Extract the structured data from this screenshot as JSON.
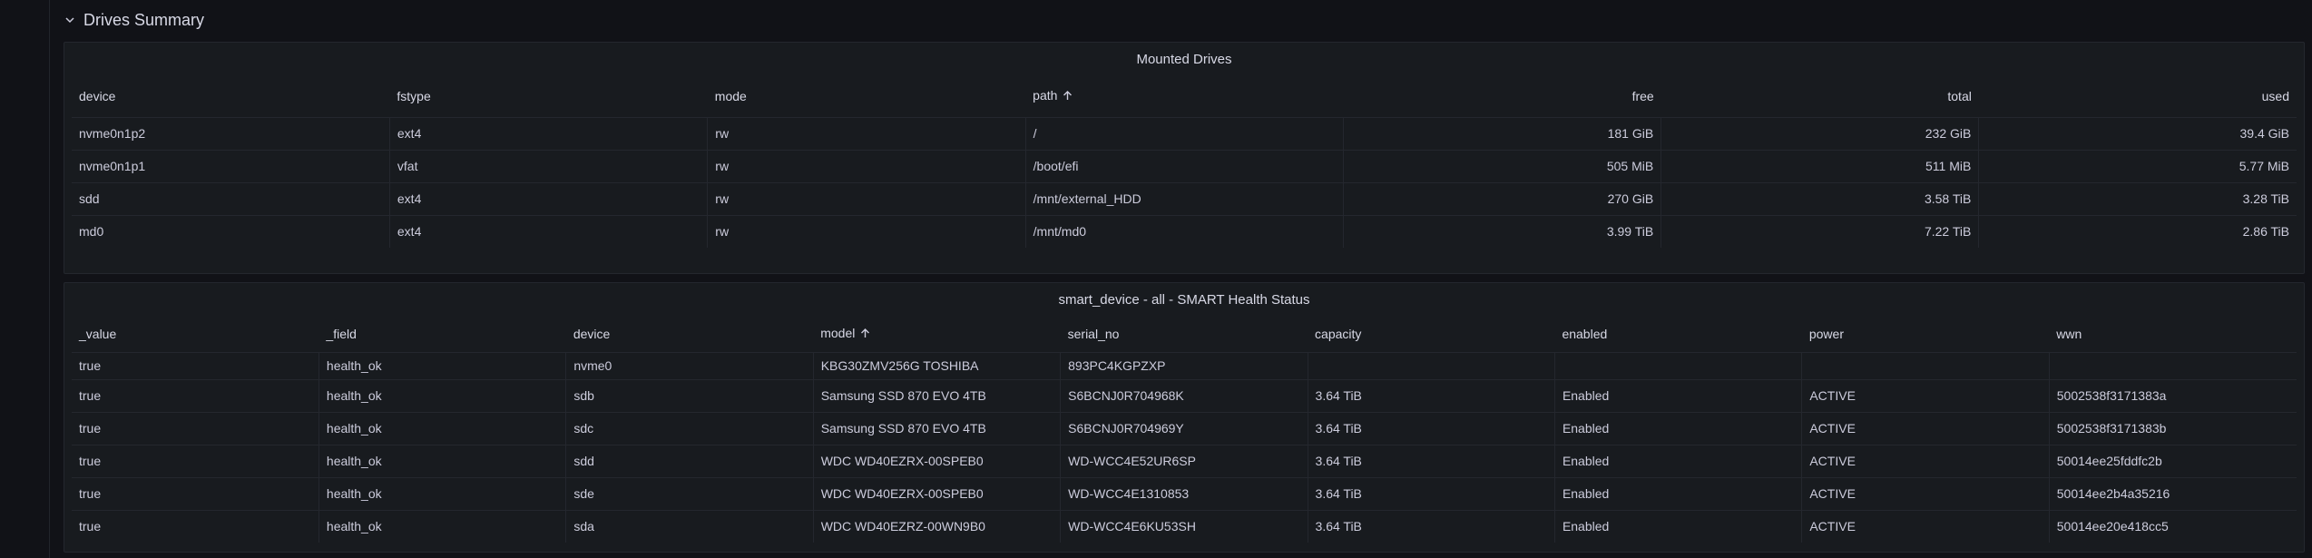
{
  "row": {
    "title": "Drives Summary"
  },
  "mounted": {
    "title": "Mounted Drives",
    "columns": [
      "device",
      "fstype",
      "mode",
      "path",
      "free",
      "total",
      "used"
    ],
    "rows": [
      [
        "nvme0n1p2",
        "ext4",
        "rw",
        "/",
        "181 GiB",
        "232 GiB",
        "39.4 GiB"
      ],
      [
        "nvme0n1p1",
        "vfat",
        "rw",
        "/boot/efi",
        "505 MiB",
        "511 MiB",
        "5.77 MiB"
      ],
      [
        "sdd",
        "ext4",
        "rw",
        "/mnt/external_HDD",
        "270 GiB",
        "3.58 TiB",
        "3.28 TiB"
      ],
      [
        "md0",
        "ext4",
        "rw",
        "/mnt/md0",
        "3.99 TiB",
        "7.22 TiB",
        "2.86 TiB"
      ]
    ]
  },
  "smart": {
    "title": "smart_device - all - SMART Health Status",
    "columns": [
      "_value",
      "_field",
      "device",
      "model",
      "serial_no",
      "capacity",
      "enabled",
      "power",
      "wwn"
    ],
    "rows": [
      [
        "true",
        "health_ok",
        "nvme0",
        "KBG30ZMV256G TOSHIBA",
        "893PC4KGPZXP",
        "",
        "",
        "",
        ""
      ],
      [
        "true",
        "health_ok",
        "sdb",
        "Samsung SSD 870 EVO 4TB",
        "S6BCNJ0R704968K",
        "3.64 TiB",
        "Enabled",
        "ACTIVE",
        "5002538f3171383a"
      ],
      [
        "true",
        "health_ok",
        "sdc",
        "Samsung SSD 870 EVO 4TB",
        "S6BCNJ0R704969Y",
        "3.64 TiB",
        "Enabled",
        "ACTIVE",
        "5002538f3171383b"
      ],
      [
        "true",
        "health_ok",
        "sdd",
        "WDC WD40EZRX-00SPEB0",
        "WD-WCC4E52UR6SP",
        "3.64 TiB",
        "Enabled",
        "ACTIVE",
        "50014ee25fddfc2b"
      ],
      [
        "true",
        "health_ok",
        "sde",
        "WDC WD40EZRX-00SPEB0",
        "WD-WCC4E1310853",
        "3.64 TiB",
        "Enabled",
        "ACTIVE",
        "50014ee2b4a35216"
      ],
      [
        "true",
        "health_ok",
        "sda",
        "WDC WD40EZRZ-00WN9B0",
        "WD-WCC4E6KU53SH",
        "3.64 TiB",
        "Enabled",
        "ACTIVE",
        "50014ee20e418cc5"
      ]
    ]
  }
}
